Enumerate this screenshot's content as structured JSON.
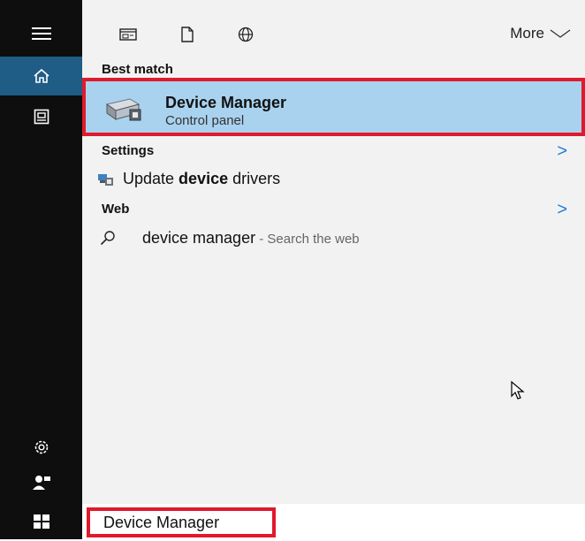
{
  "colors": {
    "rail": "#0e0e0e",
    "rail_active": "#1f5d86",
    "panel": "#f2f2f2",
    "highlight": "#a9d2ef",
    "annotation_red": "#e01a2c",
    "accent_blue": "#1f7bd6"
  },
  "rail": {
    "items": [
      {
        "icon": "hamburger-icon"
      },
      {
        "icon": "home-icon",
        "active": true
      },
      {
        "icon": "notebook-icon"
      },
      {
        "icon": "gear-icon"
      },
      {
        "icon": "feedback-icon"
      },
      {
        "icon": "windows-start-icon"
      }
    ]
  },
  "topbar": {
    "filters": [
      "apps-filter-icon",
      "documents-filter-icon",
      "web-filter-icon"
    ],
    "more_label": "More"
  },
  "sections": {
    "best_match": {
      "label": "Best match",
      "item": {
        "title": "Device Manager",
        "subtitle": "Control panel",
        "icon": "device-manager-icon"
      }
    },
    "settings": {
      "label": "Settings",
      "item": {
        "prefix": "Update ",
        "bold": "device",
        "suffix": " drivers",
        "icon": "device-drivers-icon"
      }
    },
    "web": {
      "label": "Web",
      "item": {
        "query": "device manager",
        "hint": " - Search the web",
        "icon": "search-icon"
      }
    }
  },
  "search": {
    "value": "Device Manager"
  }
}
